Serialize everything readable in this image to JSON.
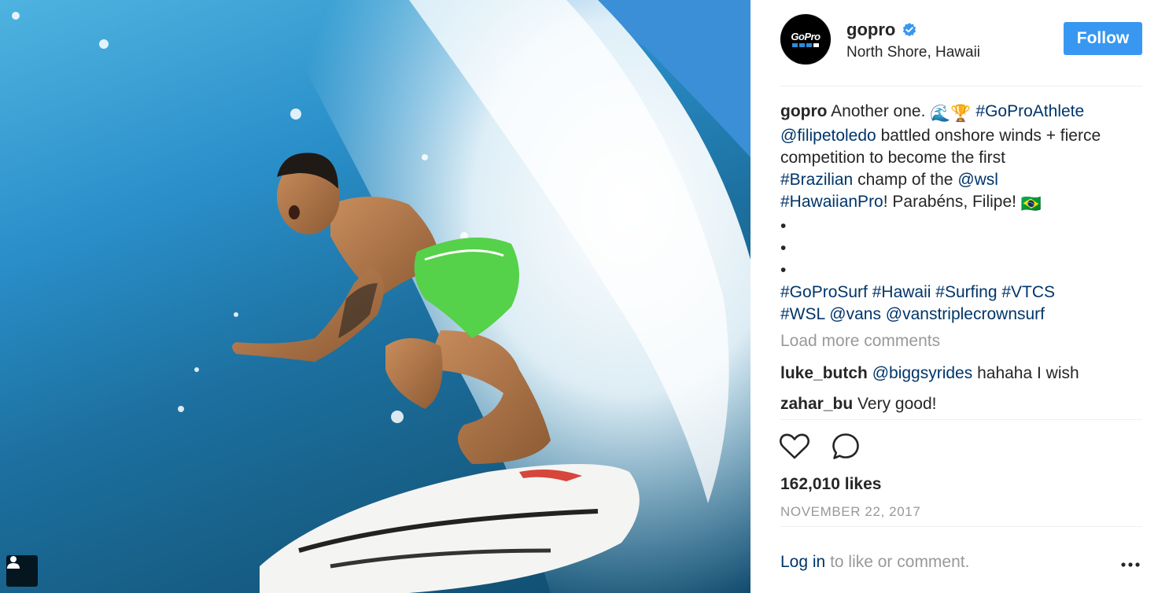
{
  "post": {
    "username": "gopro",
    "location": "North Shore, Hawaii",
    "follow_label": "Follow",
    "avatar_logo": "GoPro"
  },
  "caption": {
    "username": "gopro",
    "text_1": "Another one.",
    "emojis_1": "🌊🏆",
    "tag_athlete": "#GoProAthlete",
    "mention_filipe": "@filipetoledo",
    "text_2": "battled onshore winds + fierce competition to become the first",
    "tag_brazilian": "#Brazilian",
    "text_3": "champ of the",
    "mention_wsl": "@wsl",
    "tag_hawaiianpro": "#HawaiianPro",
    "text_4": "! Parabéns, Filipe!",
    "emoji_flag": "🇧🇷",
    "bullets": [
      "•",
      "•",
      "•"
    ],
    "tags_line": [
      "#GoProSurf",
      "#Hawaii",
      "#Surfing",
      "#VTCS",
      "#WSL",
      "@vans",
      "@vanstriplecrownsurf"
    ]
  },
  "load_more_label": "Load more comments",
  "comments": [
    {
      "user": "luke_butch",
      "mention": "@biggsyrides",
      "text": "hahaha I wish"
    },
    {
      "user": "zahar_bu",
      "mention": "",
      "text": "Very good!"
    }
  ],
  "likes": "162,010 likes",
  "date": "NOVEMBER 22, 2017",
  "login": {
    "link": "Log in",
    "rest": "to like or comment."
  },
  "icons": {
    "verified": "verified-badge-icon",
    "like": "heart-icon",
    "comment": "comment-bubble-icon",
    "more": "more-options-icon",
    "user_tag": "user-tag-icon"
  },
  "colors": {
    "follow_button": "#3897f0",
    "link": "#003569",
    "muted": "#999999",
    "verified": "#3897f0"
  }
}
